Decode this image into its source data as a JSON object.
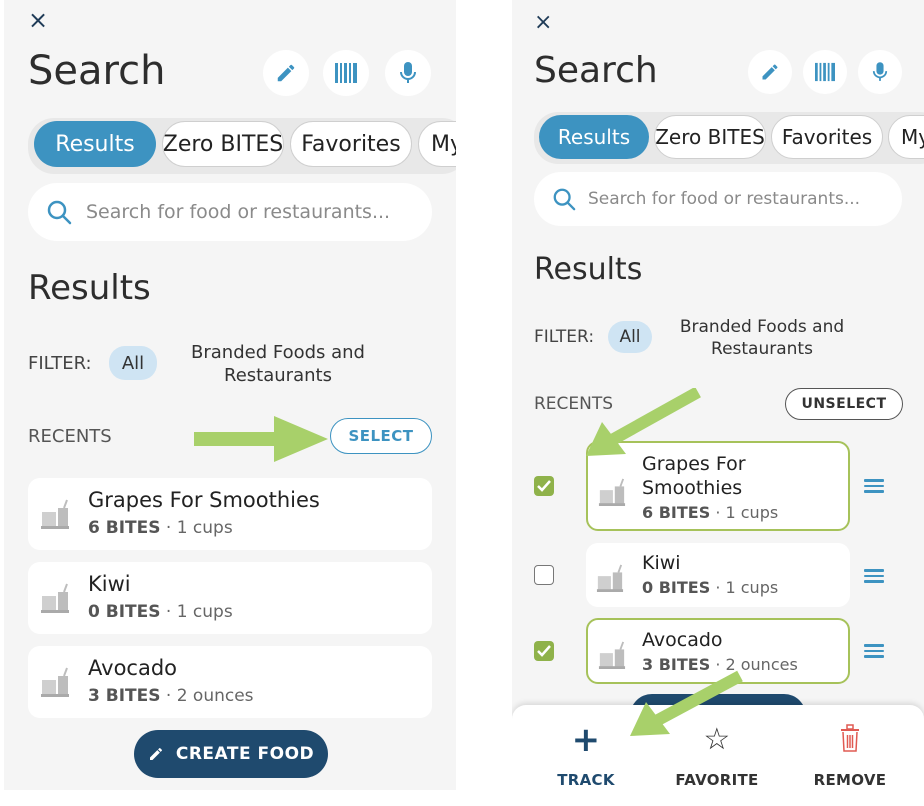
{
  "colors": {
    "accent": "#3d93c1",
    "navy": "#1f4a6e",
    "check_green": "#8fb24a",
    "select_border": "#a6c25a",
    "arrow": "#a8d06a",
    "remove_red": "#e05a52"
  },
  "left": {
    "close_icon": "×",
    "title": "Search",
    "tabs": [
      "Results",
      "Zero BITES",
      "Favorites",
      "My"
    ],
    "search_placeholder": "Search for food or restaurants...",
    "section_title": "Results",
    "filter_label": "FILTER:",
    "filter_all": "All",
    "filter_branded_line1": "Branded Foods and",
    "filter_branded_line2": "Restaurants",
    "recents_label": "RECENTS",
    "select_button": "SELECT",
    "foods": [
      {
        "name": "Grapes For Smoothies",
        "bites": "6 BITES",
        "amount": "· 1 cups"
      },
      {
        "name": "Kiwi",
        "bites": "0 BITES",
        "amount": "· 1 cups"
      },
      {
        "name": "Avocado",
        "bites": "3 BITES",
        "amount": "· 2 ounces"
      }
    ],
    "create_button": "CREATE FOOD"
  },
  "right": {
    "close_icon": "×",
    "title": "Search",
    "tabs": [
      "Results",
      "Zero BITES",
      "Favorites",
      "My"
    ],
    "search_placeholder": "Search for food or restaurants...",
    "section_title": "Results",
    "filter_label": "FILTER:",
    "filter_all": "All",
    "filter_branded_line1": "Branded Foods and",
    "filter_branded_line2": "Restaurants",
    "recents_label": "RECENTS",
    "unselect_button": "UNSELECT",
    "foods": [
      {
        "name_line1": "Grapes For",
        "name_line2": "Smoothies",
        "bites": "6 BITES",
        "amount": "· 1 cups",
        "checked": true
      },
      {
        "name_line1": "Kiwi",
        "name_line2": "",
        "bites": "0 BITES",
        "amount": "· 1 cups",
        "checked": false
      },
      {
        "name_line1": "Avocado",
        "name_line2": "",
        "bites": "3 BITES",
        "amount": "· 2 ounces",
        "checked": true
      }
    ],
    "actions": {
      "track": "TRACK",
      "favorite": "FAVORITE",
      "remove": "REMOVE",
      "track_icon": "+",
      "favorite_icon": "☆"
    }
  }
}
